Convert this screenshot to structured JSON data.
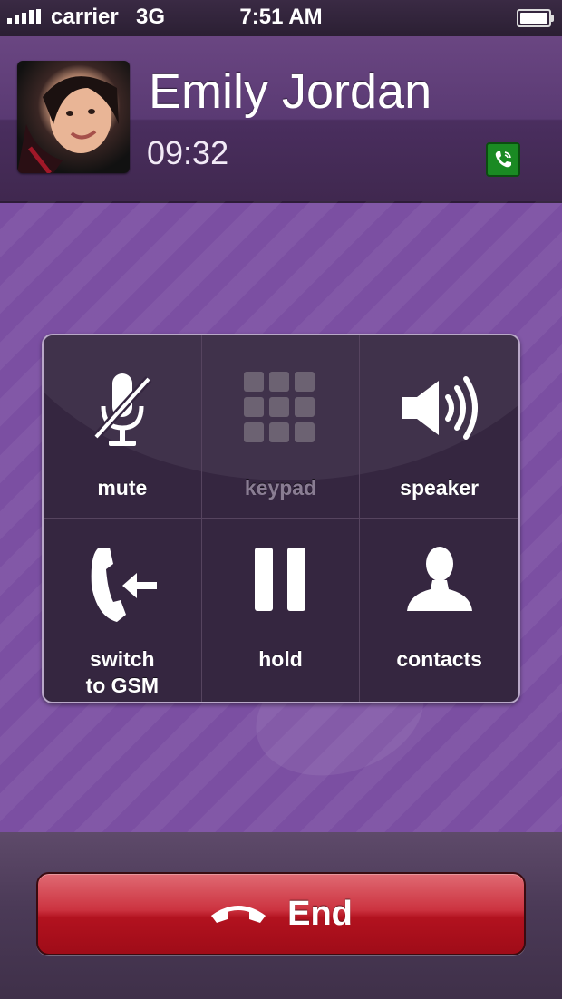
{
  "status_bar": {
    "carrier": "carrier",
    "network": "3G",
    "time": "7:51 AM"
  },
  "call": {
    "caller_name": "Emily Jordan",
    "duration": "09:32"
  },
  "controls": [
    {
      "id": "mute",
      "label": "mute",
      "icon": "microphone-muted-icon"
    },
    {
      "id": "keypad",
      "label": "keypad",
      "icon": "keypad-icon"
    },
    {
      "id": "speaker",
      "label": "speaker",
      "icon": "speaker-icon"
    },
    {
      "id": "switch",
      "label_line1": "switch",
      "label_line2": "to GSM",
      "icon": "switch-to-gsm-icon"
    },
    {
      "id": "hold",
      "label": "hold",
      "icon": "pause-icon"
    },
    {
      "id": "contacts",
      "label": "contacts",
      "icon": "contact-person-icon"
    }
  ],
  "end_button": {
    "label": "End",
    "icon": "hang-up-icon"
  },
  "colors": {
    "background": "#7b4fa2",
    "end_button": "#b2121f",
    "viber_badge": "#1a8a23"
  }
}
